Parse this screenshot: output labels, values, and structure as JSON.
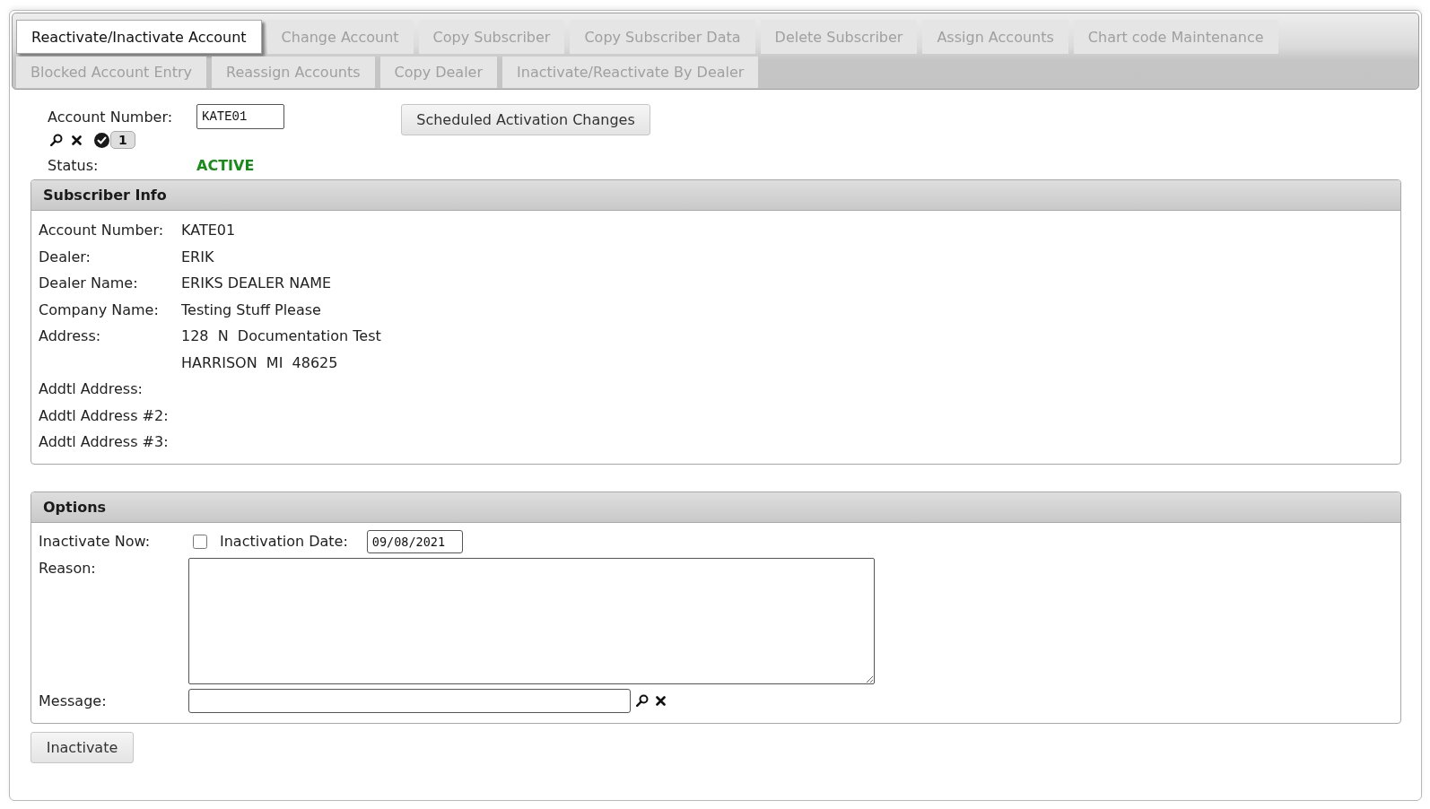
{
  "tab_rows": [
    [
      {
        "label": "Reactivate/Inactivate Account",
        "selected": true
      },
      {
        "label": "Change Account",
        "selected": false
      },
      {
        "label": "Copy Subscriber",
        "selected": false
      },
      {
        "label": "Copy Subscriber Data",
        "selected": false
      },
      {
        "label": "Delete Subscriber",
        "selected": false
      },
      {
        "label": "Assign Accounts",
        "selected": false
      },
      {
        "label": "Chart code Maintenance",
        "selected": false
      }
    ],
    [
      {
        "label": "Blocked Account Entry",
        "selected": false
      },
      {
        "label": "Reassign Accounts",
        "selected": false
      },
      {
        "label": "Copy Dealer",
        "selected": false
      },
      {
        "label": "Inactivate/Reactivate By Dealer",
        "selected": false
      }
    ]
  ],
  "account": {
    "label": "Account Number:",
    "value": "KATE01",
    "count": "1"
  },
  "scheduled_button": "Scheduled Activation Changes",
  "status": {
    "label": "Status:",
    "value": "ACTIVE"
  },
  "subscriber_info": {
    "title": "Subscriber Info",
    "rows": [
      {
        "label": "Account Number:",
        "value": "KATE01"
      },
      {
        "label": "Dealer:",
        "value": "ERIK"
      },
      {
        "label": "Dealer Name:",
        "value": "ERIKS DEALER NAME"
      },
      {
        "label": "Company Name:",
        "value": "Testing Stuff Please"
      },
      {
        "label": "Address:",
        "value": "128  N  Documentation Test"
      },
      {
        "value": "HARRISON  MI  48625"
      },
      {
        "label": "Addtl Address:"
      },
      {
        "label": "Addtl Address #2:"
      },
      {
        "label": "Addtl Address #3:"
      }
    ]
  },
  "options": {
    "title": "Options",
    "inactivate_now": {
      "label": "Inactivate Now:",
      "checked": false
    },
    "inactivation_date": {
      "label": "Inactivation Date:",
      "value": "09/08/2021"
    },
    "reason": {
      "label": "Reason:"
    },
    "message": {
      "label": "Message:"
    }
  },
  "inactivate_button": "Inactivate"
}
